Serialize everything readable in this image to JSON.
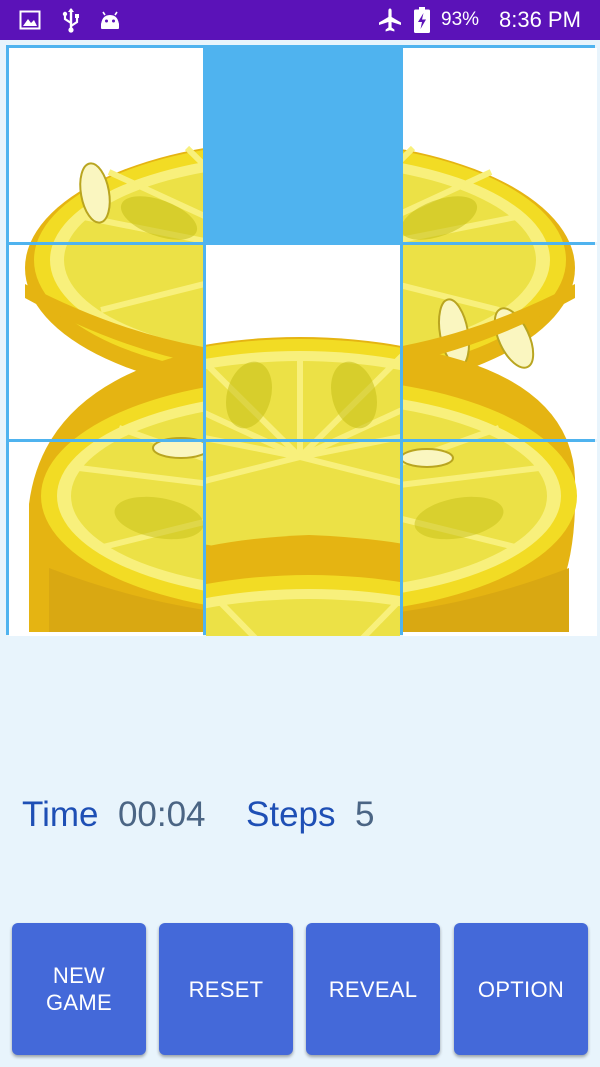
{
  "status_bar": {
    "battery": "93%",
    "time": "8:36 PM",
    "icons": [
      "gallery-icon",
      "usb-icon",
      "android-debug-icon",
      "airplane-mode-icon",
      "battery-charging-icon"
    ],
    "background": "#5b12b8"
  },
  "puzzle": {
    "grid": "3x3",
    "image": "lemon",
    "tiles": [
      {
        "slot": 0,
        "piece": 0
      },
      {
        "slot": 1,
        "piece": null
      },
      {
        "slot": 2,
        "piece": 2
      },
      {
        "slot": 3,
        "piece": 3
      },
      {
        "slot": 4,
        "piece": 1
      },
      {
        "slot": 5,
        "piece": 5
      },
      {
        "slot": 6,
        "piece": 6
      },
      {
        "slot": 7,
        "piece": 4
      },
      {
        "slot": 8,
        "piece": 8
      }
    ],
    "colors": {
      "frame": "#4fb3ef",
      "empty": "#4fb3ef",
      "lemon": "#f2dc24",
      "rind": "#e5b412",
      "pulp": "#c7c018",
      "pith": "#f8f07c"
    }
  },
  "stats": {
    "time_label": "Time",
    "time_value": "00:04",
    "steps_label": "Steps",
    "steps_value": "5"
  },
  "buttons": {
    "new_game_line1": "NEW",
    "new_game_line2": "GAME",
    "reset": "RESET",
    "reveal": "REVEAL",
    "option": "OPTION",
    "color": "#4469d9"
  }
}
